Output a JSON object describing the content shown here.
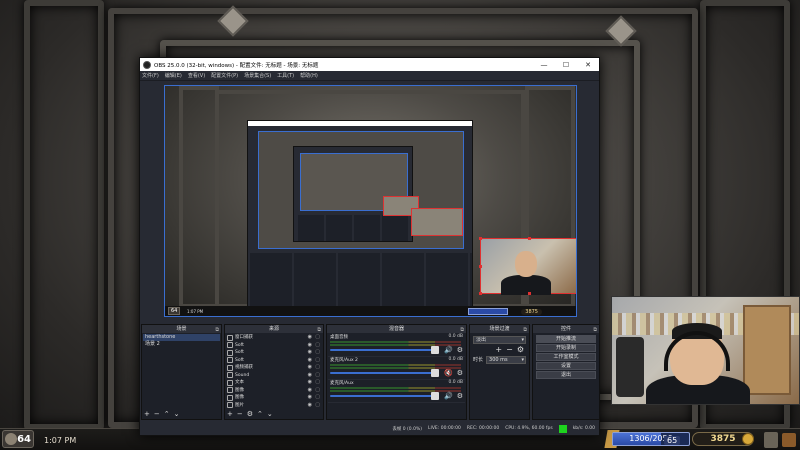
{
  "obs": {
    "title": "OBS 25.0.0 (32-bit, windows) - 配置文件: 无标题 - 场景: 无标题",
    "menu": [
      "文件(F)",
      "编辑(E)",
      "查看(V)",
      "配置文件(P)",
      "场景集合(S)",
      "工具(T)",
      "帮助(H)"
    ],
    "docks": {
      "scenes": {
        "title": "场景",
        "items": [
          "hearthstone",
          "场景 2"
        ],
        "selected": 0
      },
      "sources": {
        "title": "来源",
        "items": [
          "窗口捕获",
          "Soft",
          "Soft",
          "Soft",
          "视频捕获",
          "Sound",
          "文本",
          "图像",
          "图像",
          "图片"
        ]
      },
      "mixer": {
        "title": "混音器",
        "channels": [
          {
            "name": "桌面音频",
            "db": "0.0 dB",
            "muted": false
          },
          {
            "name": "麦克风/Aux 2",
            "db": "0.0 dB",
            "muted": true
          },
          {
            "name": "麦克风/Aux",
            "db": "0.0 dB",
            "muted": false
          }
        ]
      },
      "transitions": {
        "title": "场景过渡",
        "type": "淡出",
        "duration_label": "时长",
        "duration": "300 ms"
      },
      "controls": {
        "title": "控件",
        "buttons": [
          "开始推流",
          "开始录制",
          "工作室模式",
          "设置",
          "退出"
        ]
      }
    },
    "status": {
      "dropped": "丢帧 0 (0.0%)",
      "live": "LIVE: 00:00:00",
      "rec": "REC: 00:00:00",
      "cpu": "CPU: 4.9%, 60.00 fps",
      "bitrate": "kb/s: 0.00"
    }
  },
  "game": {
    "rank": "64",
    "clock": "1:07 PM",
    "xp": "1306/2050",
    "xp_fraction": 0.637,
    "level": "65",
    "gold": "3875"
  },
  "preview": {
    "rank": "64",
    "clock": "1:07 PM",
    "gold": "3875"
  },
  "colors": {
    "obs_bg": "#272a33",
    "dock_bg": "#1d2028",
    "selection": "#3a6ed0",
    "source_outline": "#e03030",
    "status_ok": "#1ed31e"
  }
}
